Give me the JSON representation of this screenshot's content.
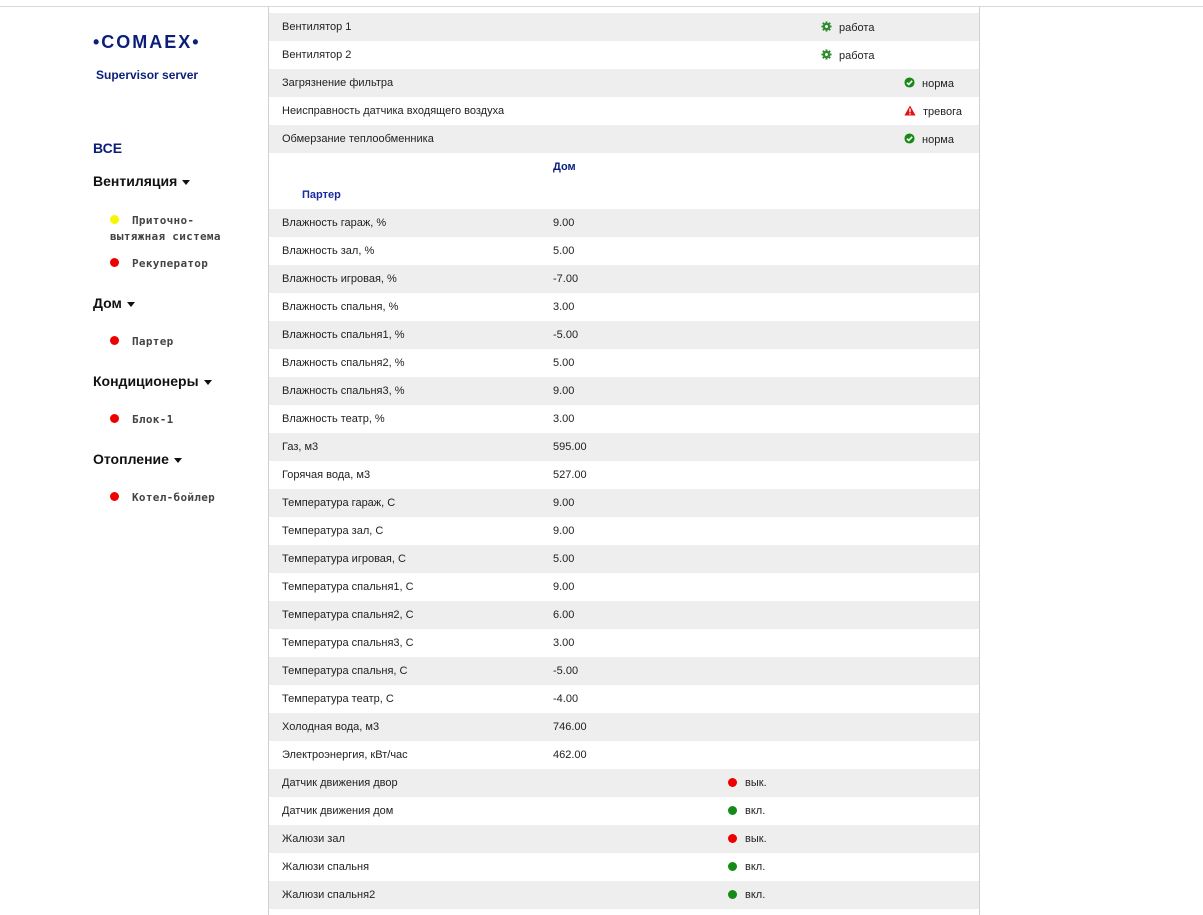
{
  "brand": {
    "logo": "•COMAEX•",
    "tagline": "Supervisor server"
  },
  "sidebar": {
    "all": "ВСЕ",
    "groups": [
      {
        "label": "Вентиляция",
        "items": [
          {
            "label1": "Приточно-",
            "label2": "вытяжная система",
            "status": "yellow"
          },
          {
            "label1": "Рекуператор",
            "status": "red"
          }
        ]
      },
      {
        "label": "Дом",
        "items": [
          {
            "label1": "Партер",
            "status": "red"
          }
        ]
      },
      {
        "label": "Кондиционеры",
        "items": [
          {
            "label1": "Блок-1",
            "status": "red"
          }
        ]
      },
      {
        "label": "Отопление",
        "items": [
          {
            "label1": "Котел-бойлер",
            "status": "red"
          }
        ]
      }
    ]
  },
  "alarms": [
    {
      "label": "Вентилятор 1",
      "status": "работа",
      "icon": "gear-icon"
    },
    {
      "label": "Вентилятор 2",
      "status": "работа",
      "icon": "gear-icon"
    },
    {
      "label": "Загрязнение фильтра",
      "status": "норма",
      "icon": "check-circle-icon"
    },
    {
      "label": "Неисправность датчика входящего воздуха",
      "status": "тревога",
      "icon": "warning-icon"
    },
    {
      "label": "Обмерзание теплообменника",
      "status": "норма",
      "icon": "check-circle-icon"
    }
  ],
  "section": {
    "title": "Дом",
    "subtitle": "Партер"
  },
  "measurements": [
    {
      "label": "Влажность гараж, %",
      "value": "9.00"
    },
    {
      "label": "Влажность зал, %",
      "value": "5.00"
    },
    {
      "label": "Влажность игровая, %",
      "value": "-7.00"
    },
    {
      "label": "Влажность спальня, %",
      "value": "3.00"
    },
    {
      "label": "Влажность спальня1, %",
      "value": "-5.00"
    },
    {
      "label": "Влажность спальня2, %",
      "value": "5.00"
    },
    {
      "label": "Влажность спальня3, %",
      "value": "9.00"
    },
    {
      "label": "Влажность театр, %",
      "value": "3.00"
    },
    {
      "label": "Газ, м3",
      "value": "595.00"
    },
    {
      "label": "Горячая вода, м3",
      "value": "527.00"
    },
    {
      "label": "Температура гараж, С",
      "value": "9.00"
    },
    {
      "label": "Температура зал, С",
      "value": "9.00"
    },
    {
      "label": "Температура игровая, С",
      "value": "5.00"
    },
    {
      "label": "Температура спальня1, С",
      "value": "9.00"
    },
    {
      "label": "Температура спальня2, С",
      "value": "6.00"
    },
    {
      "label": "Температура спальня3, С",
      "value": "3.00"
    },
    {
      "label": "Температура спальня, С",
      "value": "-5.00"
    },
    {
      "label": "Температура театр, С",
      "value": "-4.00"
    },
    {
      "label": "Холодная вода, м3",
      "value": "746.00"
    },
    {
      "label": "Электроэнергия, кВт/час",
      "value": "462.00"
    }
  ],
  "switches": [
    {
      "label": "Датчик движения двор",
      "state": "вык.",
      "color": "red"
    },
    {
      "label": "Датчик движения дом",
      "state": "вкл.",
      "color": "green"
    },
    {
      "label": "Жалюзи зал",
      "state": "вык.",
      "color": "red"
    },
    {
      "label": "Жалюзи спальня",
      "state": "вкл.",
      "color": "green"
    },
    {
      "label": "Жалюзи спальня2",
      "state": "вкл.",
      "color": "green"
    }
  ],
  "colors": {
    "brand": "#0b1e7a",
    "alarm": "#e81010",
    "ok": "#168a16",
    "row_alt": "#eeeeee"
  }
}
